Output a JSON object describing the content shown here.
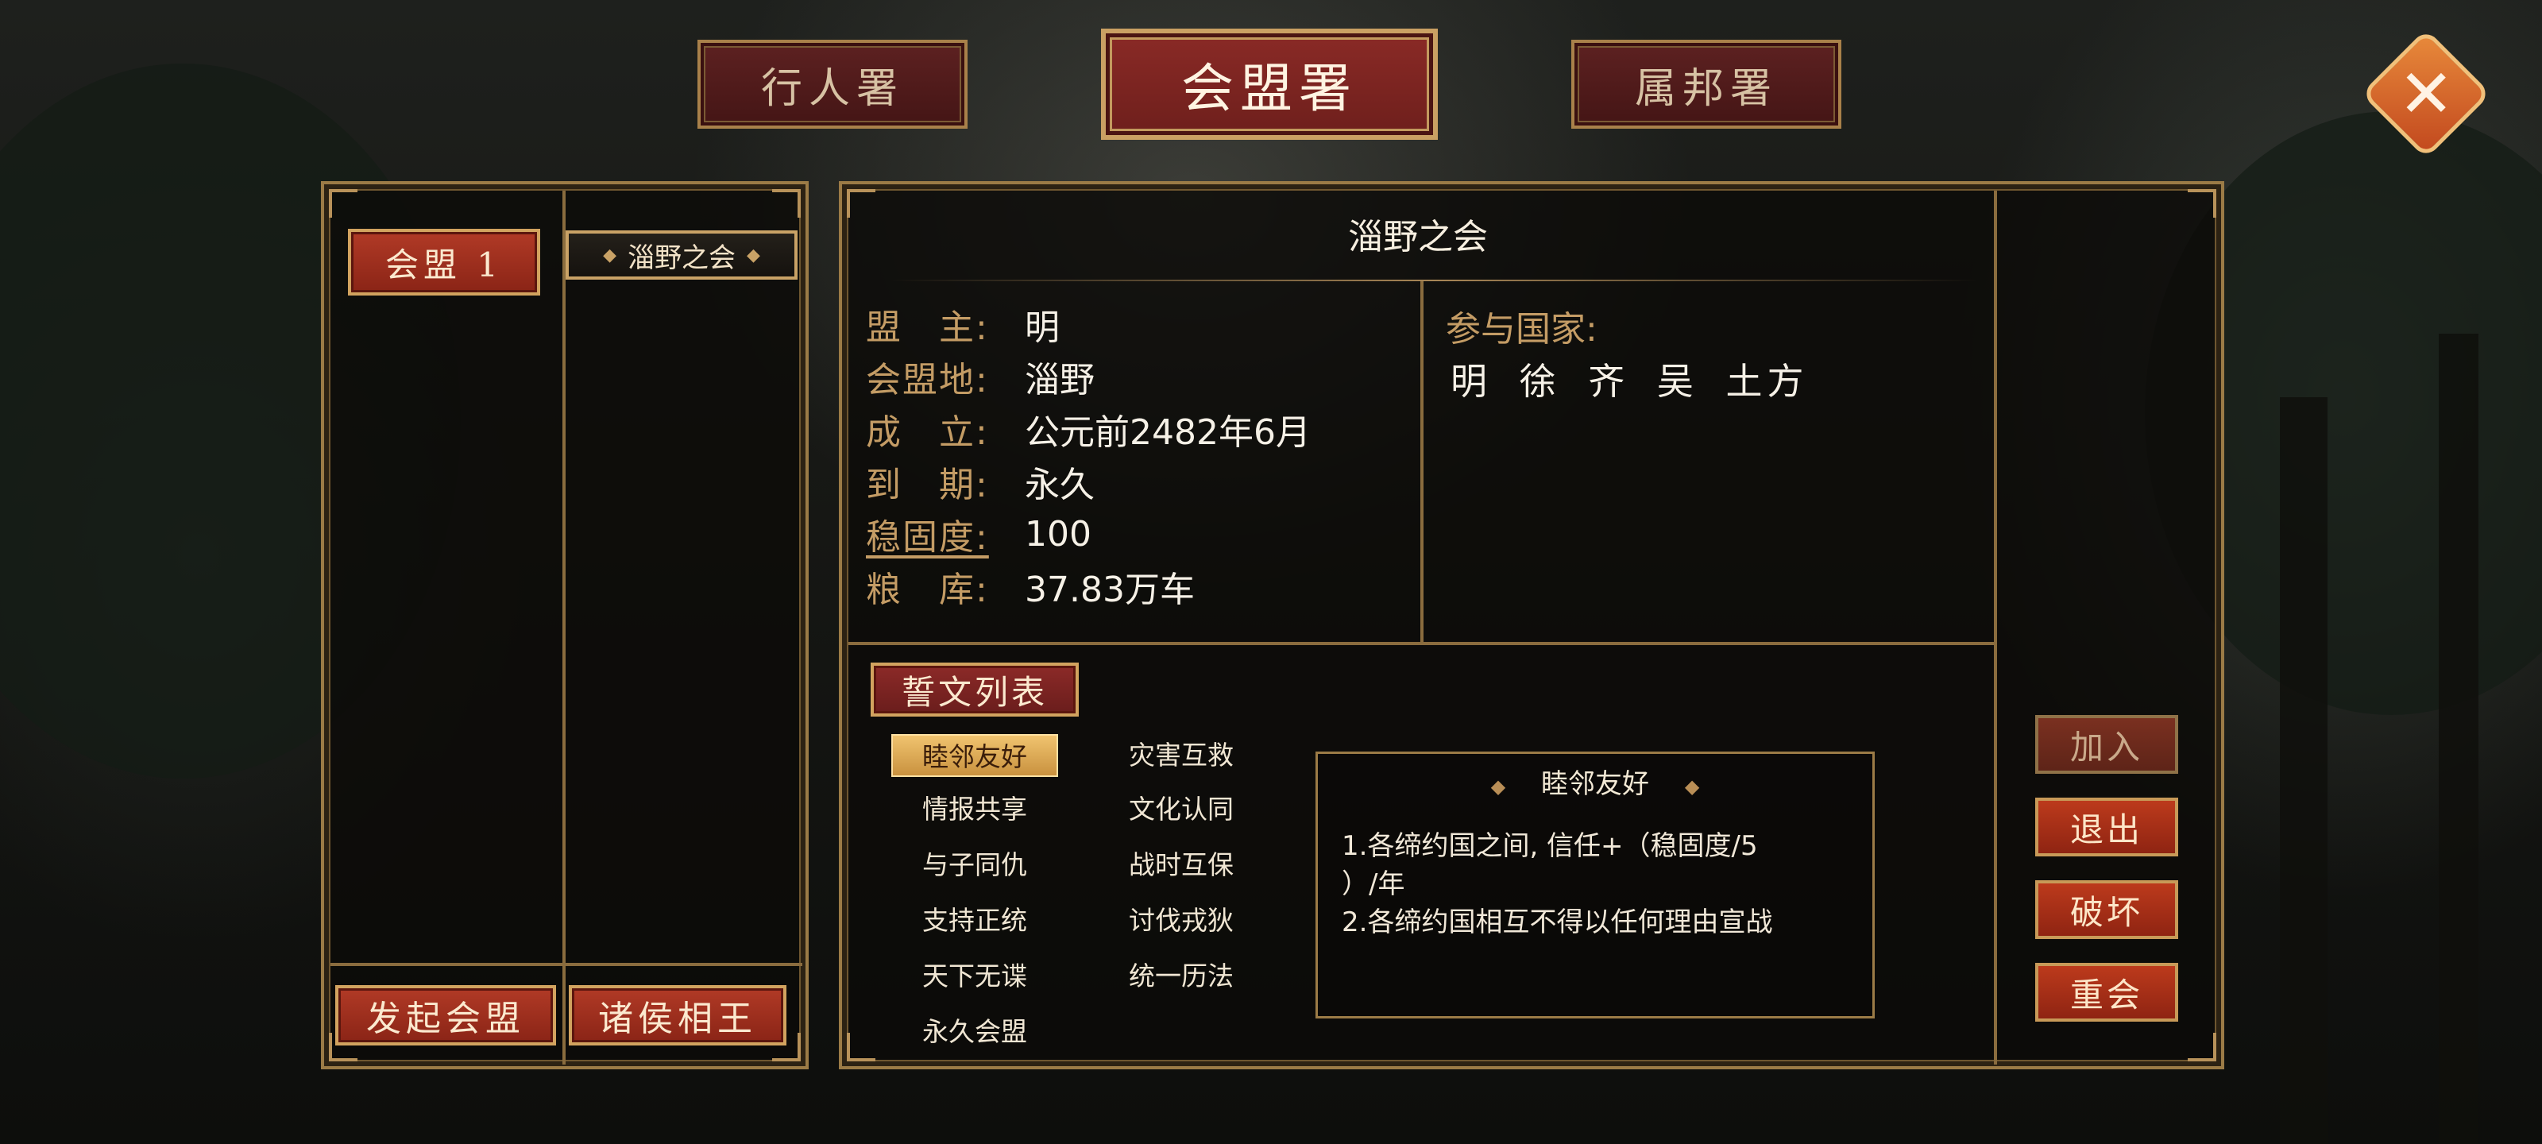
{
  "top_tabs": {
    "left": "行人署",
    "center": "会盟署",
    "right": "属邦署"
  },
  "close_label": "✕",
  "left_panel": {
    "alliance_button": "会盟 1",
    "alliance_item": "淄野之会",
    "bottom_buttons": [
      "发起会盟",
      "诸侯相王"
    ]
  },
  "details": {
    "title": "淄野之会",
    "rows": [
      {
        "key": "盟　主:",
        "value": "明"
      },
      {
        "key": "会盟地:",
        "value": "淄野"
      },
      {
        "key": "成　立:",
        "value": "公元前2482年6月"
      },
      {
        "key": "到　期:",
        "value": "永久"
      },
      {
        "key": "稳固度:",
        "value": "100"
      },
      {
        "key": "粮　库:",
        "value": "37.83万车"
      }
    ],
    "participants_label": "参与国家:",
    "participants": "明 徐 齐 吴 土方"
  },
  "oath": {
    "header": "誓文列表",
    "clauses_left": [
      "睦邻友好",
      "情报共享",
      "与子同仇",
      "支持正统",
      "天下无谍",
      "永久会盟"
    ],
    "clauses_right": [
      "灾害互救",
      "文化认同",
      "战时互保",
      "讨伐戎狄",
      "统一历法"
    ],
    "selected": "睦邻友好",
    "detail_title": "睦邻友好",
    "detail_lines": [
      "1.各缔约国之间, 信任+（稳固度/5",
      "）/年",
      "2.各缔约国相互不得以任何理由宣战"
    ]
  },
  "side_buttons": [
    "加入",
    "退出",
    "破坏",
    "重会"
  ],
  "colors": {
    "gold": "#c9a26a",
    "red_button": "#b13a26",
    "panel_border": "#9b7b46"
  }
}
